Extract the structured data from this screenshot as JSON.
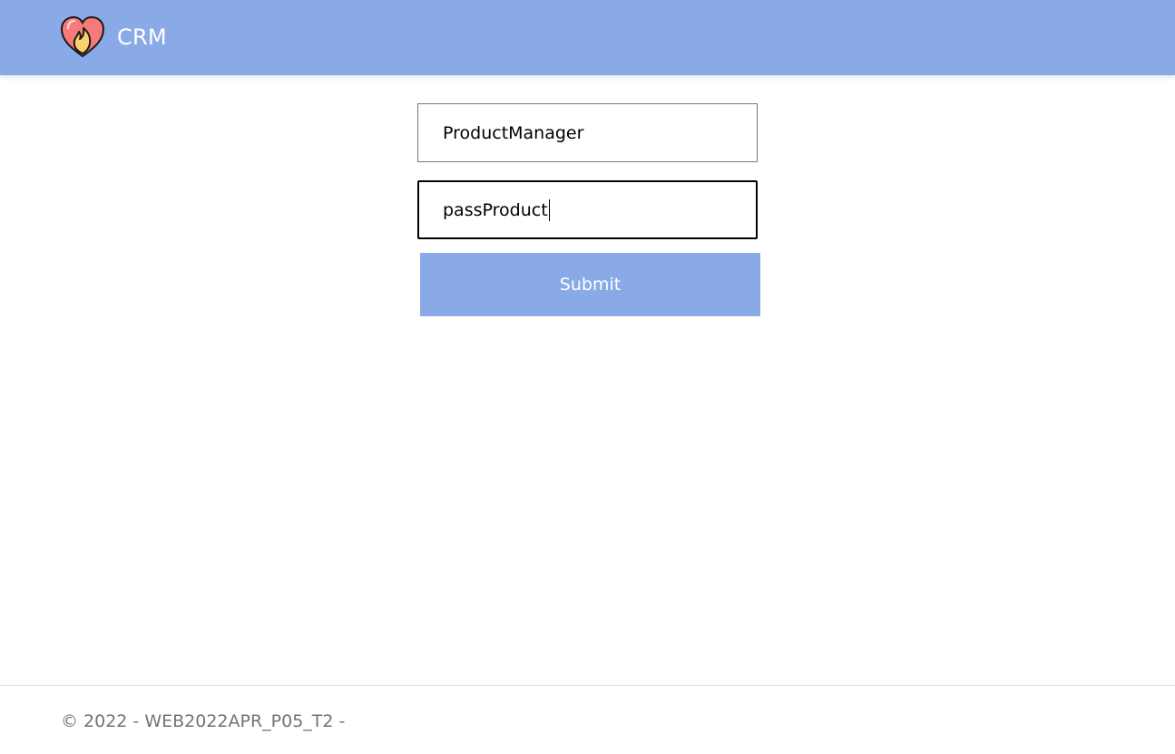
{
  "header": {
    "brand_name": "CRM",
    "logo_icon": "heart-flame-icon",
    "background_color": "#8aaae7"
  },
  "login_form": {
    "username_value": "ProductManager",
    "password_value": "passProduct",
    "submit_label": "Submit",
    "submit_color": "#8aaae7"
  },
  "footer": {
    "text": "© 2022 - WEB2022APR_P05_T2 -"
  }
}
